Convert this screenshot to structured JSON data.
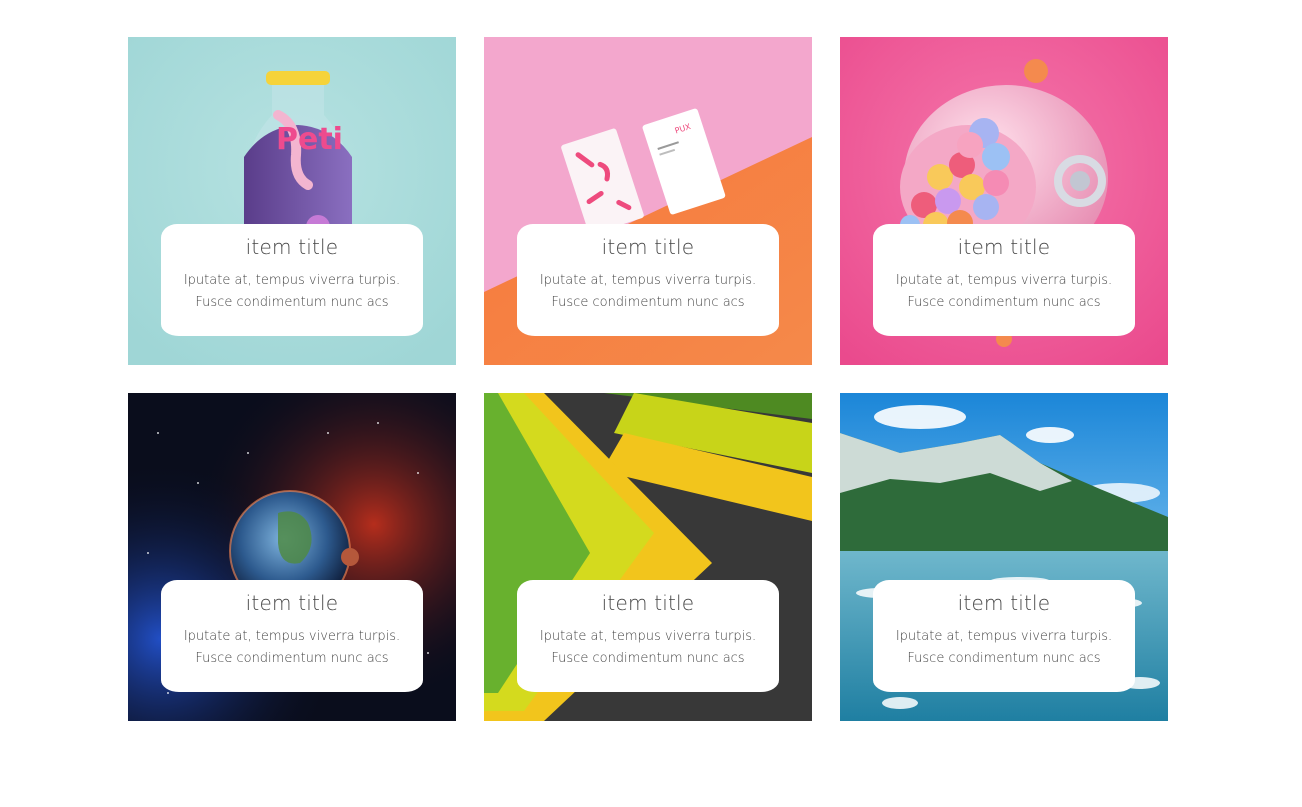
{
  "items": [
    {
      "image_name": "juice-bottle-image",
      "title": "item title",
      "description": "Iputate at, tempus viverra turpis. Fusce condimentum nunc acs",
      "bg": "#a9dcdc"
    },
    {
      "image_name": "business-cards-image",
      "title": "item title",
      "description": "Iputate at, tempus viverra turpis. Fusce condimentum nunc acs",
      "bg": "#f3a6cc"
    },
    {
      "image_name": "gumball-helmet-image",
      "title": "item title",
      "description": "Iputate at, tempus viverra turpis. Fusce condimentum nunc acs",
      "bg": "#ef5a9b"
    },
    {
      "image_name": "planet-earth-image",
      "title": "item title",
      "description": "Iputate at, tempus viverra turpis. Fusce condimentum nunc acs",
      "bg": "#0a0d1c"
    },
    {
      "image_name": "material-stripes-image",
      "title": "item title",
      "description": "Iputate at, tempus viverra turpis. Fusce condimentum nunc acs",
      "bg": "#383838"
    },
    {
      "image_name": "mountain-lake-image",
      "title": "item title",
      "description": "Iputate at, tempus viverra turpis. Fusce condimentum nunc acs",
      "bg": "#1d8fde"
    }
  ]
}
